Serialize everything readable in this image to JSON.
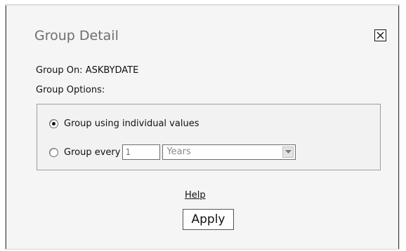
{
  "dialog": {
    "title": "Group Detail",
    "group_on": "Group On: ASKBYDATE",
    "group_options_label": "Group Options:",
    "options": {
      "individual_values_label": "Group using individual values",
      "group_every_label": "Group every",
      "interval_value": "1",
      "unit_selected": "Years",
      "selected_option": "Group using individual values"
    },
    "help_label": "Help",
    "apply_label": "Apply",
    "icons": {
      "close": "close-icon",
      "dropdown": "chevron-down-icon"
    }
  }
}
